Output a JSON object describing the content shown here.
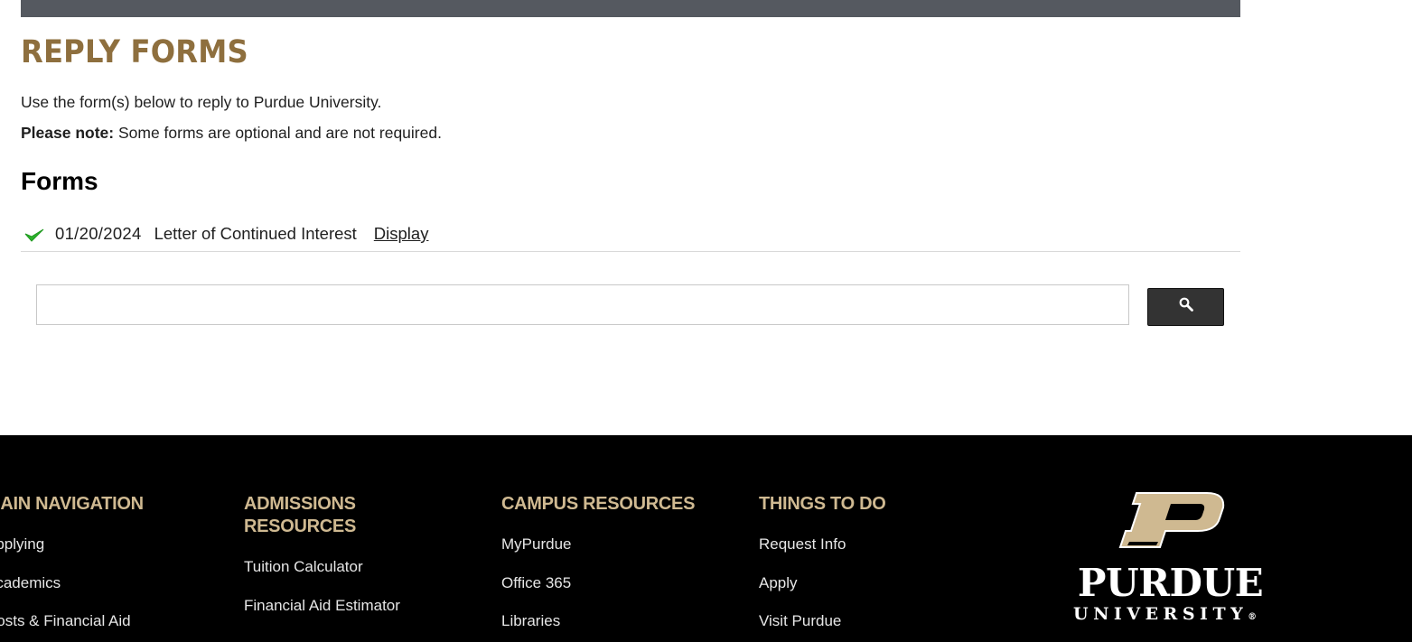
{
  "page": {
    "title": "REPLY FORMS",
    "intro": "Use the form(s) below to reply to Purdue University.",
    "note_label": "Please note:",
    "note_text": " Some forms are optional and are not required."
  },
  "forms": {
    "heading": "Forms",
    "items": [
      {
        "status_icon": "green-check-icon",
        "date": "01/20/2024",
        "name": "Letter of Continued Interest",
        "link": "Display"
      }
    ]
  },
  "search": {
    "value": "",
    "placeholder": "",
    "button_icon": "search-icon"
  },
  "footer": {
    "columns": [
      {
        "heading": "MAIN NAVIGATION",
        "links": [
          "Applying",
          "Academics",
          "Costs & Financial Aid"
        ]
      },
      {
        "heading": "ADMISSIONS RESOURCES",
        "links": [
          "Tuition Calculator",
          "Financial Aid Estimator"
        ]
      },
      {
        "heading": "CAMPUS RESOURCES",
        "links": [
          "MyPurdue",
          "Office 365",
          "Libraries"
        ]
      },
      {
        "heading": "THINGS TO DO",
        "links": [
          "Request Info",
          "Apply",
          "Visit Purdue"
        ]
      }
    ],
    "logo": {
      "wordmark": "PURDUE",
      "subtext": "UNIVERSITY",
      "registered": "®"
    }
  },
  "colors": {
    "title_gold": "#8e6f3e",
    "footer_gold": "#cfb991",
    "top_bar": "#555960",
    "check_green": "#2db22d",
    "footer_bg": "#000000"
  }
}
